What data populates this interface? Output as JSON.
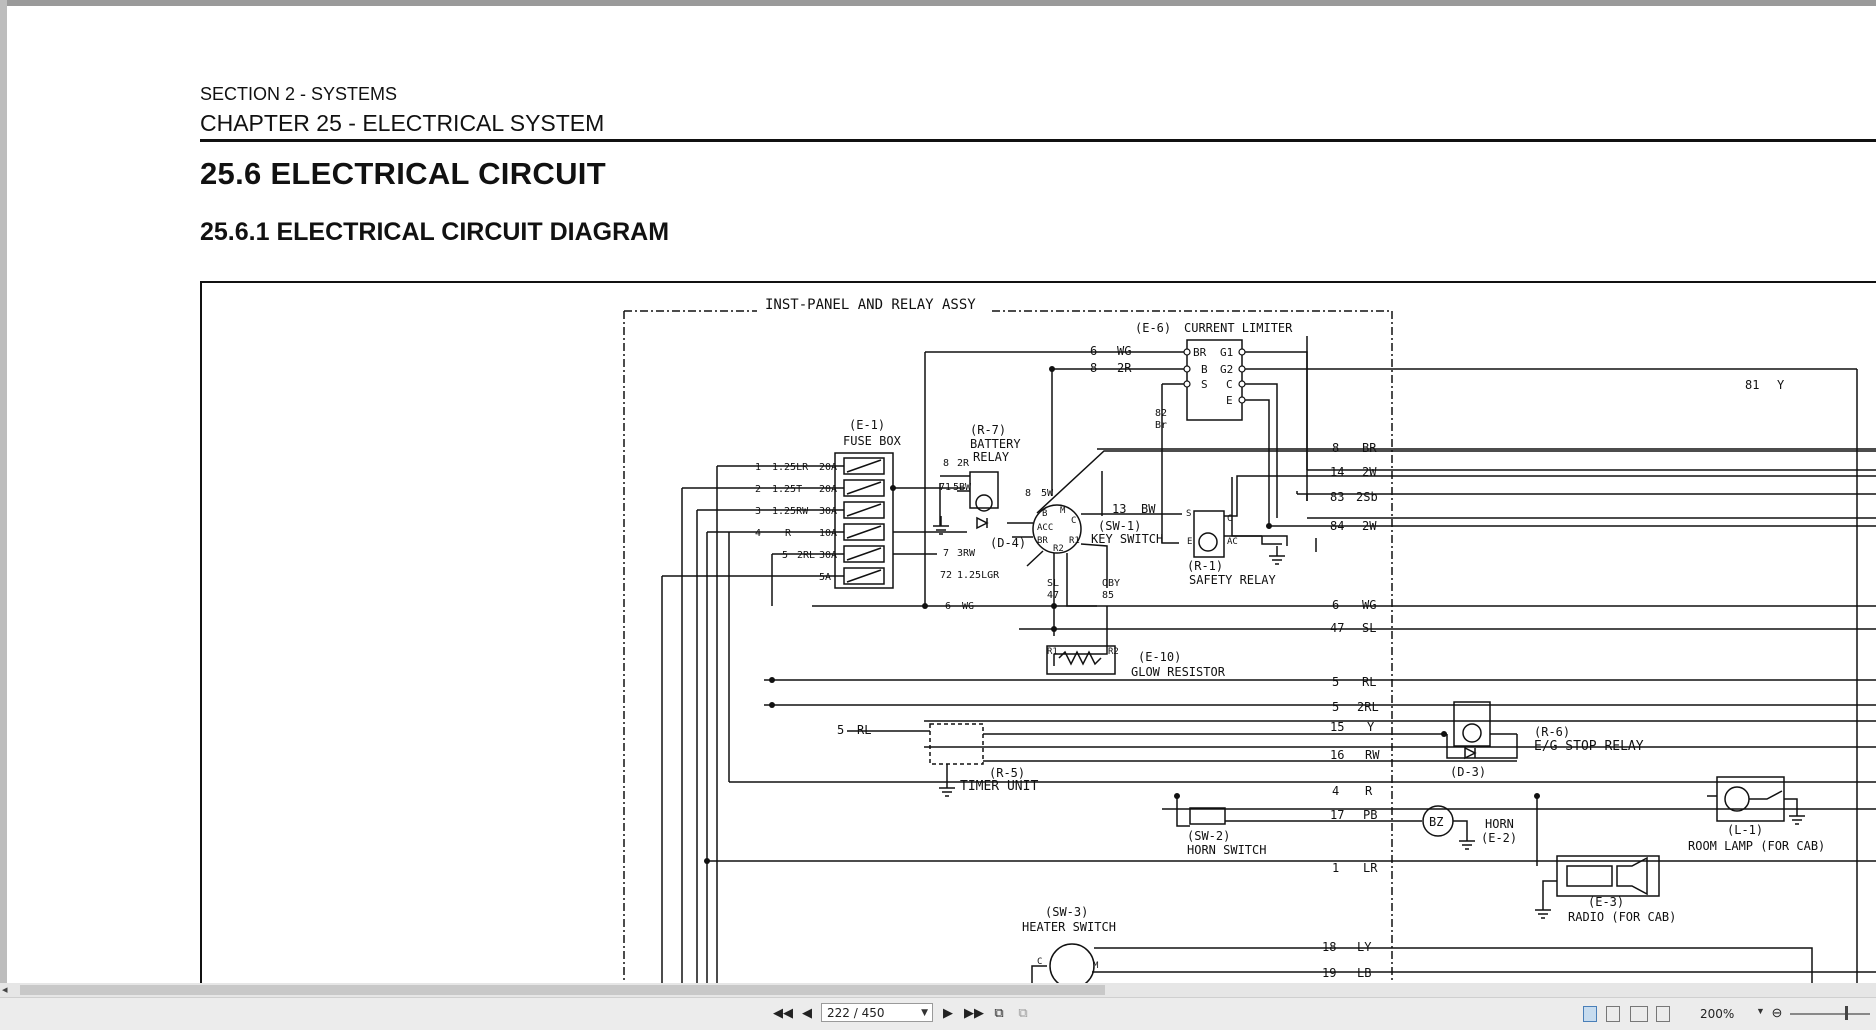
{
  "document": {
    "section": "SECTION 2 - SYSTEMS",
    "chapter": "CHAPTER 25 - ELECTRICAL SYSTEM",
    "title": "25.6  ELECTRICAL CIRCUIT",
    "subtitle": "25.6.1  ELECTRICAL CIRCUIT DIAGRAM"
  },
  "diagram": {
    "labels": {
      "inst_panel": "INST-PANEL AND RELAY ASSY",
      "e6_id": "(E-6)",
      "e6_name": "CURRENT LIMITER",
      "e1_id": "(E-1)",
      "e1_name": "FUSE BOX",
      "r7_id": "(R-7)",
      "r7_name1": "BATTERY",
      "r7_name2": "RELAY",
      "d4": "(D-4)",
      "sw1_id": "(SW-1)",
      "sw1_name": "KEY SWITCH",
      "r1_id": "(R-1)",
      "r1_name": "SAFETY RELAY",
      "e10_id": "(E-10)",
      "e10_name": "GLOW RESISTOR",
      "r5_id": "(R-5)",
      "r5_name": "TIMER UNIT",
      "r6_id": "(R-6)",
      "r6_name": "E/G STOP RELAY",
      "d3": "(D-3)",
      "sw2_id": "(SW-2)",
      "sw2_name": "HORN SWITCH",
      "bz": "BZ",
      "horn_name": "HORN",
      "e2_id": "(E-2)",
      "l1_id": "(L-1)",
      "l1_name": "ROOM LAMP (FOR CAB)",
      "e3_id": "(E-3)",
      "e3_name": "RADIO (FOR CAB)",
      "sw3_id": "(SW-3)",
      "sw3_name": "HEATER SWITCH"
    },
    "limiter_pins": [
      "BR",
      "B",
      "S",
      "G1",
      "G2",
      "C",
      "E"
    ],
    "fuses": [
      {
        "n": "1",
        "wire": "1.25LR",
        "amp": "20A"
      },
      {
        "n": "2",
        "wire": "1.25T",
        "amp": "20A"
      },
      {
        "n": "3",
        "wire": "1.25RW",
        "amp": "30A"
      },
      {
        "n": "4",
        "wire": "R",
        "amp": "10A"
      },
      {
        "n": "5",
        "wire": "2RL",
        "amp": "30A"
      },
      {
        "n": "",
        "wire": "",
        "amp": "5A"
      }
    ],
    "wires_right": [
      {
        "n": "8",
        "c": "BR"
      },
      {
        "n": "14",
        "c": "2W"
      },
      {
        "n": "83",
        "c": "2Sb"
      },
      {
        "n": "84",
        "c": "2W"
      },
      {
        "n": "6",
        "c": "WG"
      },
      {
        "n": "47",
        "c": "SL"
      },
      {
        "n": "5",
        "c": "RL"
      },
      {
        "n": "5",
        "c": "2RL"
      },
      {
        "n": "15",
        "c": "Y"
      },
      {
        "n": "16",
        "c": "RW"
      },
      {
        "n": "4",
        "c": "R"
      },
      {
        "n": "17",
        "c": "PB"
      },
      {
        "n": "1",
        "c": "LR"
      },
      {
        "n": "18",
        "c": "LY"
      },
      {
        "n": "19",
        "c": "LB"
      }
    ],
    "wires_top": [
      {
        "n": "6",
        "c": "WG"
      },
      {
        "n": "8",
        "c": "2R"
      },
      {
        "n": "81",
        "c": "Y"
      },
      {
        "n": "82",
        "c": "Br"
      }
    ],
    "misc_wires": [
      {
        "n": "8",
        "c": "2R"
      },
      {
        "n": "71",
        "c": "5BW"
      },
      {
        "n": "8",
        "c": "5W"
      },
      {
        "n": "13",
        "c": "BW"
      },
      {
        "n": "7",
        "c": "3RW"
      },
      {
        "n": "72",
        "c": "1.25LGR"
      },
      {
        "n": "6",
        "c": "WG"
      },
      {
        "n": "47",
        "c": "SL"
      },
      {
        "n": "85",
        "c": "OBY"
      },
      {
        "n": "5",
        "c": "RL"
      }
    ],
    "key_pins": [
      "B",
      "ACC",
      "BR",
      "R2",
      "R1",
      "C",
      "M"
    ],
    "sw3_pins": [
      "C",
      "M"
    ],
    "relay_pins": [
      "S",
      "C",
      "E",
      "AC"
    ],
    "resistor_pins": [
      "R1",
      "R2"
    ]
  },
  "toolbar": {
    "page_display": "222 / 450",
    "zoom": "200%"
  }
}
